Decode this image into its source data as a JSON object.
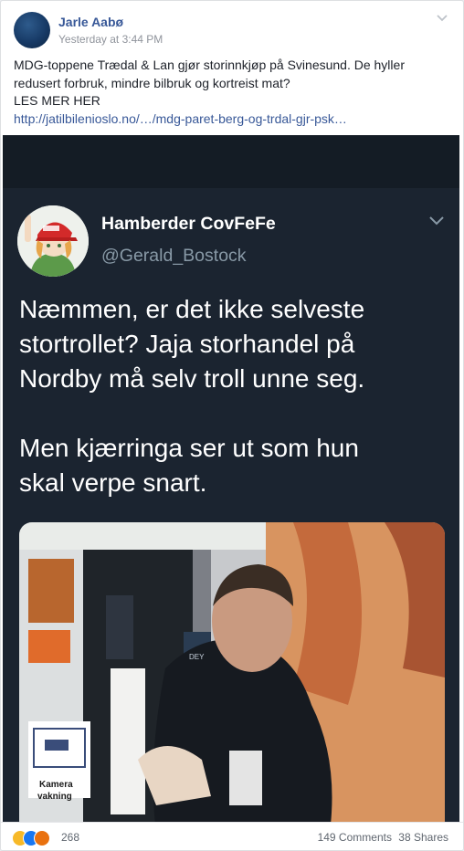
{
  "post": {
    "author": "Jarle Aabø",
    "timestamp": "Yesterday at 3:44 PM",
    "text_lines": [
      "MDG-toppene Trædal & Lan gjør storinnkjøp på Svinesund. De hyller",
      "redusert forbruk, mindre bilbruk og kortreist mat?",
      "LES MER HER"
    ],
    "link": "http://jatilbilenioslo.no/…/mdg-paret-berg-og-trdal-gjr-psk…"
  },
  "tweet": {
    "name": "Hamberder CovFeFe",
    "handle": "@Gerald_Bostock",
    "paragraph1": [
      "Næmmen, er det ikke selveste",
      "stortrollet? Jaja storhandel på",
      "Nordby må selv troll unne seg."
    ],
    "paragraph2": [
      "Men kjærringa ser ut som hun",
      "skal verpe snart."
    ],
    "sign_text": [
      "Kamera",
      "vakning"
    ],
    "shelf_text": "DEY"
  },
  "footer": {
    "reaction_count": "268",
    "comments": "149 Comments",
    "shares": "38 Shares"
  },
  "icons": [
    "chevron-down-icon",
    "laugh-reaction-icon",
    "like-reaction-icon",
    "angry-reaction-icon",
    "camera-sign-icon"
  ],
  "colors": {
    "link": "#385898",
    "name": "#385898",
    "tweet_bg": "#1b2430",
    "tweet_handle": "#8899a6",
    "meta": "#90949c"
  }
}
